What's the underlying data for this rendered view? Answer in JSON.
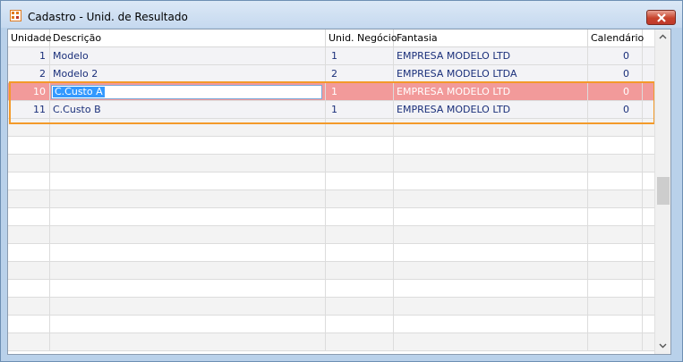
{
  "window": {
    "title": "Cadastro - Unid. de Resultado",
    "icon": "app-icon",
    "close_icon": "close-icon"
  },
  "table": {
    "columns": [
      "Unidade",
      "Descrição",
      "Unid. Negócio",
      "Fantasia",
      "Calendário"
    ],
    "rows": [
      {
        "unidade": "1",
        "descricao": "Modelo",
        "unid_negocio": "1",
        "fantasia": "EMPRESA MODELO LTD",
        "calendario": "0"
      },
      {
        "unidade": "2",
        "descricao": "Modelo 2",
        "unid_negocio": "2",
        "fantasia": "EMPRESA MODELO LTDA",
        "calendario": "0"
      },
      {
        "unidade": "10",
        "descricao": "C.Custo A",
        "unid_negocio": "1",
        "fantasia": "EMPRESA MODELO LTD",
        "calendario": "0"
      },
      {
        "unidade": "11",
        "descricao": "C.Custo B",
        "unid_negocio": "1",
        "fantasia": "EMPRESA MODELO LTD",
        "calendario": "0"
      }
    ],
    "selected_row": 2,
    "highlighted_rows": [
      2,
      3
    ]
  },
  "colors": {
    "selected_row": "#f29a9a",
    "highlight_border": "#f39a2a",
    "cell_text": "#1a2f7a",
    "editor_selection": "#3399ff"
  },
  "scrollbar": {
    "up_icon": "chevron-up-icon",
    "down_icon": "chevron-down-icon"
  }
}
